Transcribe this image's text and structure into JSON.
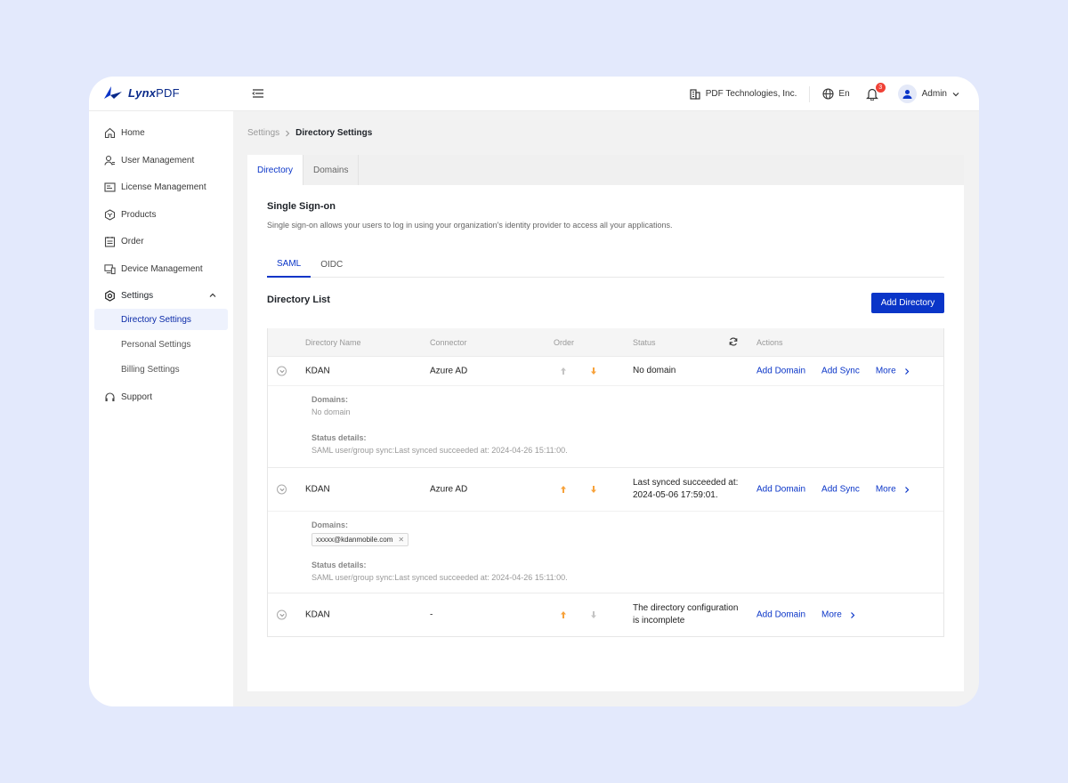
{
  "brand": {
    "name_bold": "Lynx",
    "name_light": "PDF"
  },
  "header": {
    "org": "PDF Technologies, Inc.",
    "lang": "En",
    "notifications": "3",
    "user": "Admin"
  },
  "sidebar": {
    "items": [
      {
        "label": "Home"
      },
      {
        "label": "User Management"
      },
      {
        "label": "License Management"
      },
      {
        "label": "Products"
      },
      {
        "label": "Order"
      },
      {
        "label": "Device Management"
      },
      {
        "label": "Settings"
      },
      {
        "label": "Support"
      }
    ],
    "settings_sub": [
      {
        "label": "Directory Settings"
      },
      {
        "label": "Personal Settings"
      },
      {
        "label": "Billing Settings"
      }
    ]
  },
  "breadcrumb": {
    "parent": "Settings",
    "current": "Directory Settings"
  },
  "tabs": [
    "Directory",
    "Domains"
  ],
  "sso": {
    "title": "Single Sign-on",
    "desc": "Single sign-on allows your users to log in using your organization's identity provider to access all your applications."
  },
  "subtabs": [
    "SAML",
    "OIDC"
  ],
  "list": {
    "title": "Directory List",
    "add_button": "Add Directory",
    "columns": [
      "Directory Name",
      "Connector",
      "Order",
      "Status",
      "Actions"
    ],
    "rows": [
      {
        "name": "KDAN",
        "connector": "Azure AD",
        "status": "No domain",
        "actions": [
          "Add Domain",
          "Add Sync"
        ],
        "more": "More",
        "domains_label": "Domains:",
        "domains_value": "No domain",
        "status_label": "Status details:",
        "status_value": "SAML user/group sync:Last synced succeeded at: 2024-04-26 15:11:00."
      },
      {
        "name": "KDAN",
        "connector": "Azure AD",
        "status": "Last synced succeeded at: 2024-05-06 17:59:01.",
        "actions": [
          "Add Domain",
          "Add Sync"
        ],
        "more": "More",
        "domains_label": "Domains:",
        "domain_chip": "xxxxx@kdanmobile.com",
        "status_label": "Status details:",
        "status_value": "SAML user/group sync:Last synced succeeded at: 2024-04-26 15:11:00."
      },
      {
        "name": "KDAN",
        "connector": "-",
        "status": "The directory configuration is incomplete",
        "actions": [
          "Add Domain"
        ],
        "more": "More"
      }
    ]
  },
  "colors": {
    "accent": "#0a35c8",
    "order_active": "#f7a23b",
    "order_inactive": "#c4c4c4"
  }
}
